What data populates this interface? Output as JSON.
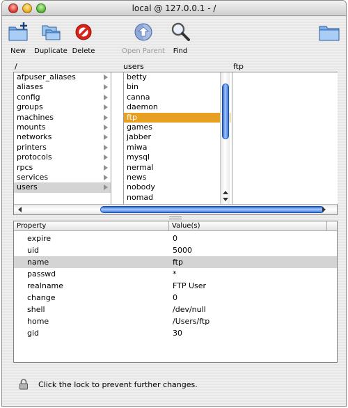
{
  "window": {
    "title": "local @ 127.0.0.1 - /"
  },
  "toolbar": {
    "new_label": "New",
    "duplicate_label": "Duplicate",
    "delete_label": "Delete",
    "open_parent_label": "Open Parent",
    "find_label": "Find"
  },
  "browser": {
    "column_headers": [
      "/",
      "users",
      "ftp"
    ],
    "col1": [
      "afpuser_aliases",
      "aliases",
      "config",
      "groups",
      "machines",
      "mounts",
      "networks",
      "printers",
      "protocols",
      "rpcs",
      "services",
      "users"
    ],
    "col1_selected": "users",
    "col2": [
      "betty",
      "bin",
      "canna",
      "daemon",
      "ftp",
      "games",
      "jabber",
      "miwa",
      "mysql",
      "nermal",
      "news",
      "nobody",
      "nomad"
    ],
    "col2_selected": "ftp"
  },
  "properties": {
    "header_property": "Property",
    "header_value": "Value(s)",
    "rows": [
      {
        "key": "expire",
        "value": "0"
      },
      {
        "key": "uid",
        "value": "5000"
      },
      {
        "key": "name",
        "value": "ftp"
      },
      {
        "key": "passwd",
        "value": "*"
      },
      {
        "key": "realname",
        "value": "FTP User"
      },
      {
        "key": "change",
        "value": "0"
      },
      {
        "key": "shell",
        "value": "/dev/null"
      },
      {
        "key": "home",
        "value": "/Users/ftp"
      },
      {
        "key": "gid",
        "value": "30"
      }
    ],
    "selected_key": "name"
  },
  "status": {
    "lock_text": "Click the lock to prevent further changes."
  },
  "colors": {
    "selection_orange": "#e8a023",
    "selection_gray": "#d4d4d4",
    "scroll_blue": "#3f7ae0"
  },
  "icons": [
    "new-folder-icon",
    "duplicate-icon",
    "delete-icon",
    "open-parent-icon",
    "find-icon",
    "folder-icon",
    "lock-icon"
  ]
}
